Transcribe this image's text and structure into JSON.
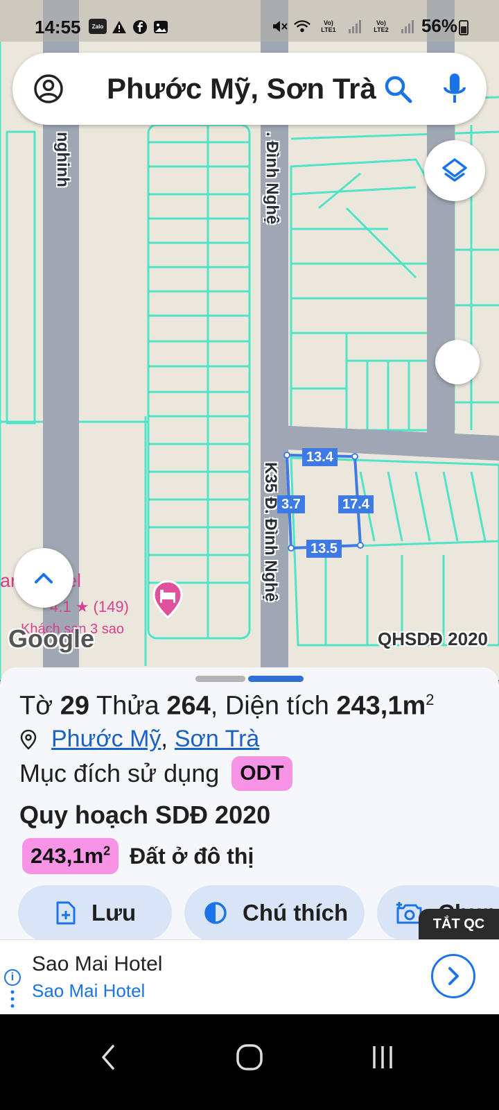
{
  "status_bar": {
    "time": "14:55",
    "battery": "56%",
    "icons": [
      "zalo-icon",
      "warning-icon",
      "facebook-icon",
      "gallery-icon",
      "mute-icon",
      "wifi-icon",
      "lte1-signal-icon",
      "lte2-signal-icon",
      "battery-icon"
    ],
    "zalo_label": "Zalo",
    "sim1_label": "LTE1",
    "sim2_label": "LTE2"
  },
  "search": {
    "query": "Phước Mỹ, Sơn Trà"
  },
  "map": {
    "streets": {
      "left_street": "nghinh",
      "top_street": ". Đình Nghệ",
      "bottom_street": "K35 Đ. Đình Nghệ"
    },
    "plot_dimensions": {
      "top": "13.4",
      "left": "3.7",
      "right": "17.4",
      "bottom": "13.5"
    },
    "poi": {
      "name": "ar    n Hotel",
      "rating": "4.1 ★ (149)",
      "type": "Khách sạn 3 sao"
    },
    "google_logo": "Google",
    "layer_name": "QHSDĐ 2020"
  },
  "sheet": {
    "sheet_prefix": "Tờ ",
    "sheet_no": "29",
    "parcel_prefix": " Thửa ",
    "parcel_no": "264",
    "area_prefix": ", Diện tích ",
    "area_value": "243,1m",
    "area_unit_sup": "2",
    "location_ward": "Phước Mỹ",
    "location_sep": ",",
    "location_district": "Sơn Trà",
    "purpose_label": "Mục đích sử dụng",
    "purpose_code": "ODT",
    "plan_title": "Quy hoạch SDĐ 2020",
    "plan_area": "243,1m",
    "plan_area_sup": "2",
    "plan_desc": "Đất ở đô thị",
    "actions": {
      "save": "Lưu",
      "legend": "Chú thích",
      "capture": "Chụp"
    }
  },
  "ad": {
    "off_label": "TẮT QC",
    "title": "Sao Mai Hotel",
    "subtitle": "Sao Mai Hotel"
  },
  "colors": {
    "accent_blue": "#1a73e8",
    "plot_blue": "#3d7ae6",
    "badge_pink": "#f794e6",
    "parcel_lines": "#4fe3c8",
    "road_gray": "#9ea7b3"
  }
}
